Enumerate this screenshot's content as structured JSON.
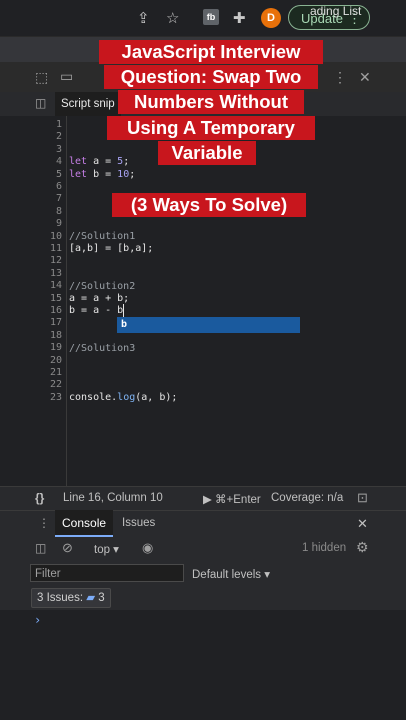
{
  "browser": {
    "extension_label": "fb",
    "avatar_letter": "D",
    "update_label": "Update",
    "update_menu": "⋮",
    "bookmark_partial": "ading List"
  },
  "devtools": {
    "snippet_tab": "Script snip",
    "close_glyph": "✕",
    "more_glyph": "⋮"
  },
  "editor": {
    "line_numbers": [
      "1",
      "2",
      "3",
      "4",
      "5",
      "6",
      "7",
      "8",
      "9",
      "10",
      "11",
      "12",
      "13",
      "14",
      "15",
      "16",
      "17",
      "18",
      "19",
      "20",
      "21",
      "22",
      "23"
    ],
    "lines": {
      "l4_kw": "let",
      "l4_rest": " a = ",
      "l4_num": "5",
      "l4_end": ";",
      "l5_kw": "let",
      "l5_rest": " b = ",
      "l5_num": "10",
      "l5_end": ";",
      "l10": "//Solution1",
      "l11": "[a,b] = [b,a];",
      "l15": "//Solution2",
      "l16": "a = a + b;",
      "l17": "b = a - b",
      "l20": "//Solution3",
      "l23_obj": "console.",
      "l23_fn": "log",
      "l23_rest": "(a, b);"
    },
    "autocomplete": "b"
  },
  "overlay": {
    "title_lines": [
      "JavaScript Interview",
      "Question: Swap Two",
      "Numbers Without",
      "Using A Temporary",
      "Variable"
    ],
    "subtitle": "(3 Ways To Solve)"
  },
  "status": {
    "braces": "{}",
    "position": "Line 16, Column 10",
    "run": "▶ ⌘+Enter",
    "coverage": "Coverage: n/a"
  },
  "console": {
    "tab_console": "Console",
    "tab_issues": "Issues",
    "context": "top ▾",
    "hidden": "1 hidden",
    "filter_placeholder": "Filter",
    "levels": "Default levels ▾",
    "issues_label": "3 Issues:",
    "issues_count": "3",
    "prompt": "›"
  }
}
